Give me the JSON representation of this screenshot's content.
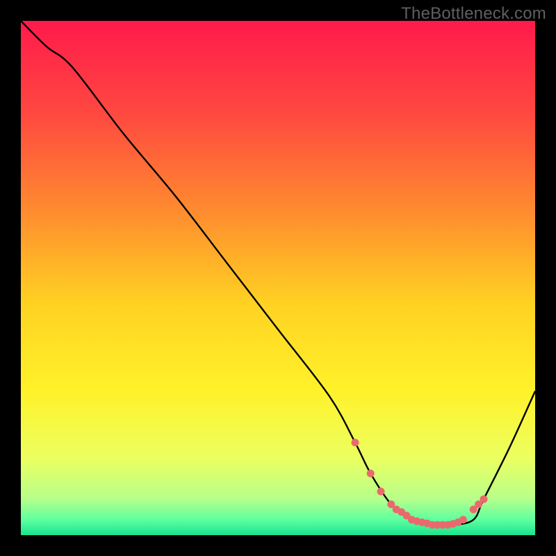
{
  "watermark": "TheBottleneck.com",
  "chart_data": {
    "type": "line",
    "title": "",
    "xlabel": "",
    "ylabel": "",
    "xlim": [
      0,
      100
    ],
    "ylim": [
      0,
      100
    ],
    "series": [
      {
        "name": "curve",
        "x": [
          0,
          5,
          10,
          20,
          30,
          40,
          50,
          60,
          65,
          68,
          72,
          76,
          80,
          84,
          88,
          90,
          95,
          100
        ],
        "y": [
          100,
          95,
          91,
          78,
          66,
          53,
          40,
          27,
          18,
          12,
          6,
          3,
          2,
          2,
          3,
          7,
          17,
          28
        ]
      }
    ],
    "markers": {
      "name": "flat-zone-dots",
      "color": "#e96a6c",
      "x": [
        65,
        68,
        70,
        72,
        73,
        74,
        75,
        76,
        77,
        78,
        79,
        80,
        81,
        82,
        83,
        84,
        85,
        86,
        88,
        89,
        90
      ],
      "y": [
        18,
        12,
        8.5,
        6,
        5,
        4.5,
        3.8,
        3,
        2.7,
        2.5,
        2.3,
        2,
        2,
        2,
        2,
        2.2,
        2.5,
        3,
        5,
        6,
        7
      ]
    },
    "background": {
      "type": "vertical-gradient",
      "stops": [
        {
          "offset": 0.0,
          "color": "#ff1a4b"
        },
        {
          "offset": 0.18,
          "color": "#ff4840"
        },
        {
          "offset": 0.38,
          "color": "#ff8f2e"
        },
        {
          "offset": 0.55,
          "color": "#ffd222"
        },
        {
          "offset": 0.72,
          "color": "#fff22a"
        },
        {
          "offset": 0.85,
          "color": "#ecff60"
        },
        {
          "offset": 0.93,
          "color": "#b6ff8a"
        },
        {
          "offset": 0.97,
          "color": "#5effa0"
        },
        {
          "offset": 1.0,
          "color": "#19e48e"
        }
      ]
    }
  }
}
